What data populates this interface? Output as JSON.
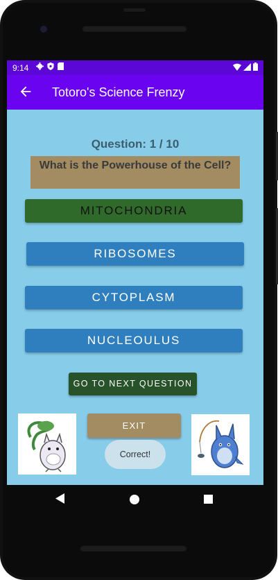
{
  "status_bar": {
    "time": "9:14"
  },
  "app_bar": {
    "title": "Totoro's Science Frenzy"
  },
  "quiz": {
    "counter": "Question: 1 / 10",
    "question": "What is the Powerhouse of the Cell?",
    "answers": [
      {
        "label": "MITOCHONDRIA",
        "state": "correct",
        "color": "#306a2b"
      },
      {
        "label": "RIBOSOMES",
        "state": "normal",
        "color": "#2f7fbf"
      },
      {
        "label": "CYTOPLASM",
        "state": "normal",
        "color": "#2f7fbf"
      },
      {
        "label": "NUCLEOULUS",
        "state": "normal",
        "color": "#2f7fbf"
      }
    ],
    "next_label": "GO TO NEXT QUESTION",
    "exit_label": "EXIT"
  },
  "toast": {
    "text": "Correct!"
  },
  "images": {
    "left": "white-totoro-with-leaf",
    "right": "blue-totoro-fishing"
  },
  "colors": {
    "screen_bg": "#87cdea",
    "status_bar": "#5b08d6",
    "app_bar": "#6a04f0",
    "question_box": "#a38c62",
    "next_button": "#27522a",
    "exit_button": "#a38c62"
  }
}
